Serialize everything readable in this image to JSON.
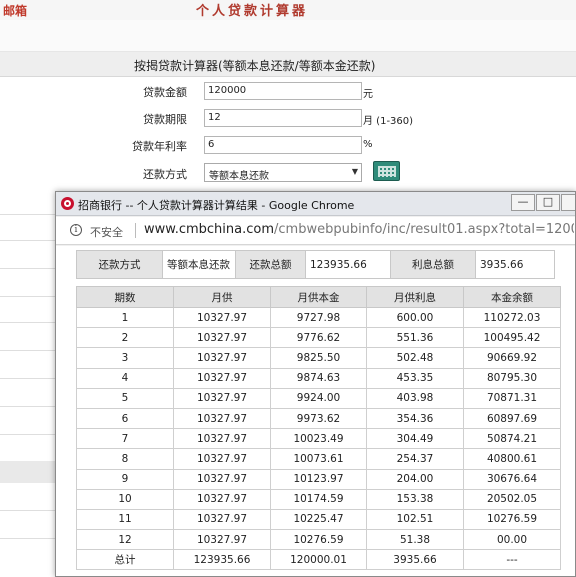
{
  "background": {
    "logo_text": "邮箱",
    "page_title": "个人贷款计算器",
    "calculator_title": "按揭贷款计算器(等额本息还款/等额本金还款)",
    "fields": {
      "amount_label": "贷款金额",
      "amount_value": "120000",
      "amount_unit": "元",
      "term_label": "贷款期限",
      "term_value": "12",
      "term_unit": "月 (1-360)",
      "rate_label": "贷款年利率",
      "rate_value": "6",
      "rate_unit": "%",
      "method_label": "还款方式",
      "method_value": "等额本息还款"
    }
  },
  "popup": {
    "title": "招商银行 -- 个人贷款计算器计算结果 - Google Chrome",
    "buttons": {
      "minimize": "—",
      "maximize": "□",
      "close": ""
    },
    "address_bar": {
      "security_text": "不安全",
      "url_host": "www.cmbchina.com",
      "url_path": "/cmbwebpubinfo/inc/result01.aspx?total=12000..."
    },
    "summary": {
      "method_label": "还款方式",
      "method_value": "等额本息还款",
      "total_label": "还款总额",
      "total_value": "123935.66",
      "interest_label": "利息总额",
      "interest_value": "3935.66"
    },
    "table": {
      "headers": [
        "期数",
        "月供",
        "月供本金",
        "月供利息",
        "本金余额"
      ],
      "rows": [
        [
          "1",
          "10327.97",
          "9727.98",
          "600.00",
          "110272.03"
        ],
        [
          "2",
          "10327.97",
          "9776.62",
          "551.36",
          "100495.42"
        ],
        [
          "3",
          "10327.97",
          "9825.50",
          "502.48",
          "90669.92"
        ],
        [
          "4",
          "10327.97",
          "9874.63",
          "453.35",
          "80795.30"
        ],
        [
          "5",
          "10327.97",
          "9924.00",
          "403.98",
          "70871.31"
        ],
        [
          "6",
          "10327.97",
          "9973.62",
          "354.36",
          "60897.69"
        ],
        [
          "7",
          "10327.97",
          "10023.49",
          "304.49",
          "50874.21"
        ],
        [
          "8",
          "10327.97",
          "10073.61",
          "254.37",
          "40800.61"
        ],
        [
          "9",
          "10327.97",
          "10123.97",
          "204.00",
          "30676.64"
        ],
        [
          "10",
          "10327.97",
          "10174.59",
          "153.38",
          "20502.05"
        ],
        [
          "11",
          "10327.97",
          "10225.47",
          "102.51",
          "10276.59"
        ],
        [
          "12",
          "10327.97",
          "10276.59",
          "51.38",
          "00.00"
        ]
      ],
      "total_row": [
        "总计",
        "123935.66",
        "120000.01",
        "3935.66",
        "---"
      ]
    }
  }
}
